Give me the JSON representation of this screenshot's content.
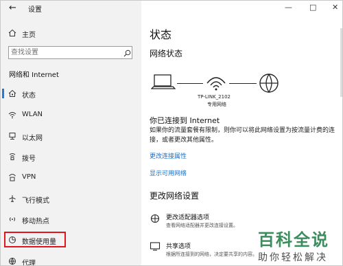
{
  "window": {
    "title": "设置"
  },
  "sidebar": {
    "home": "主页",
    "search_placeholder": "查找设置",
    "section": "网络和 Internet",
    "items": [
      {
        "label": "状态",
        "icon": "home-network-icon"
      },
      {
        "label": "WLAN",
        "icon": "wifi-icon"
      },
      {
        "label": "以太网",
        "icon": "ethernet-icon"
      },
      {
        "label": "拨号",
        "icon": "dialup-icon"
      },
      {
        "label": "VPN",
        "icon": "vpn-icon"
      },
      {
        "label": "飞行模式",
        "icon": "airplane-icon"
      },
      {
        "label": "移动热点",
        "icon": "hotspot-icon"
      },
      {
        "label": "数据使用量",
        "icon": "data-usage-icon"
      },
      {
        "label": "代理",
        "icon": "globe-icon"
      }
    ]
  },
  "main": {
    "title": "状态",
    "network_status": "网络状态",
    "router_name": "TP-LINK_2102",
    "network_type": "专用网络",
    "connected_title": "你已连接到 Internet",
    "connected_desc": "如果你的流量套餐有限制，则你可以将此网络设置为按流量计费的连接，或者更改其他属性。",
    "link_change_props": "更改连接属性",
    "link_show_networks": "显示可用网络",
    "change_settings": "更改网络设置",
    "options": [
      {
        "title": "更改适配器选项",
        "desc": "查看网络适配器并更改连接设置。"
      },
      {
        "title": "共享选项",
        "desc": "根据所连接到的网络，决定要共享的内容。"
      }
    ]
  },
  "watermark": {
    "big": "百科全说",
    "small": "助你轻松解决"
  },
  "colors": {
    "accent": "#1e7bd6",
    "highlight": "#e2141b",
    "link": "#1a6fc7"
  }
}
